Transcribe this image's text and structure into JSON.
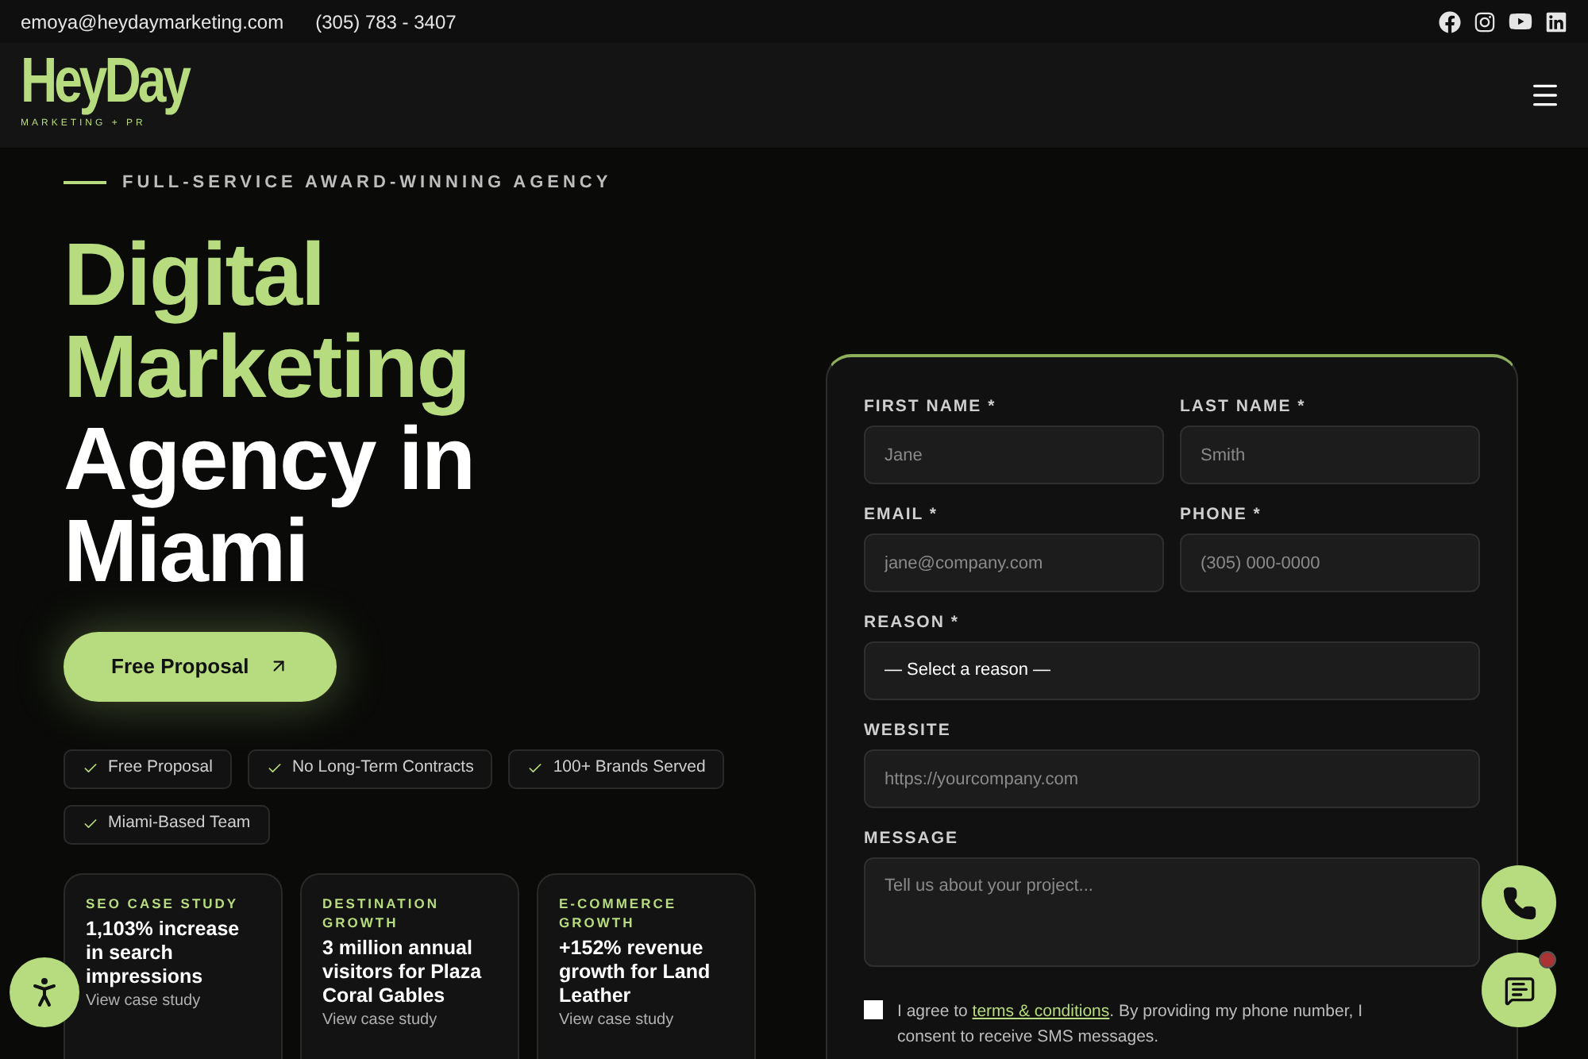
{
  "topbar": {
    "email": "emoya@heydaymarketing.com",
    "phone": "(305) 783 - 3407"
  },
  "logo": {
    "name": "HeyDay",
    "tagline": "MARKETING + PR"
  },
  "hero": {
    "eyebrow": "FULL-SERVICE AWARD-WINNING AGENCY",
    "heading": [
      {
        "text": "Digital Marketing",
        "accent": true
      },
      {
        "text": "Agency in Miami",
        "accent": false
      }
    ],
    "cta": "Free Proposal",
    "badges": [
      "Free Proposal",
      "No Long-Term Contracts",
      "100+ Brands Served",
      "Miami-Based Team"
    ],
    "cases": [
      {
        "label": "SEO CASE STUDY",
        "title": "1,103% increase in search impressions",
        "link": "View case study"
      },
      {
        "label": "DESTINATION GROWTH",
        "title": "3 million annual visitors for Plaza Coral Gables",
        "link": "View case study"
      },
      {
        "label": "E-COMMERCE GROWTH",
        "title": "+152% revenue growth for Land Leather",
        "link": "View case study"
      }
    ]
  },
  "form": {
    "fields": [
      {
        "label": "FIRST NAME *",
        "placeholder": "Jane",
        "kind": "input"
      },
      {
        "label": "LAST NAME *",
        "placeholder": "Smith",
        "kind": "input"
      },
      {
        "label": "EMAIL *",
        "placeholder": "jane@company.com",
        "kind": "input"
      },
      {
        "label": "PHONE *",
        "placeholder": "(305) 000-0000",
        "kind": "input"
      },
      {
        "label": "REASON *",
        "value": "— Select a reason —",
        "kind": "select"
      },
      {
        "label": "WEBSITE",
        "placeholder": "https://yourcompany.com",
        "kind": "input"
      },
      {
        "label": "MESSAGE",
        "placeholder": "Tell us about your project...",
        "kind": "textarea"
      }
    ],
    "consent": {
      "checked": false,
      "before": "I agree to ",
      "link": "terms & conditions",
      "after": ". By providing my phone number, I consent to receive SMS messages."
    }
  }
}
